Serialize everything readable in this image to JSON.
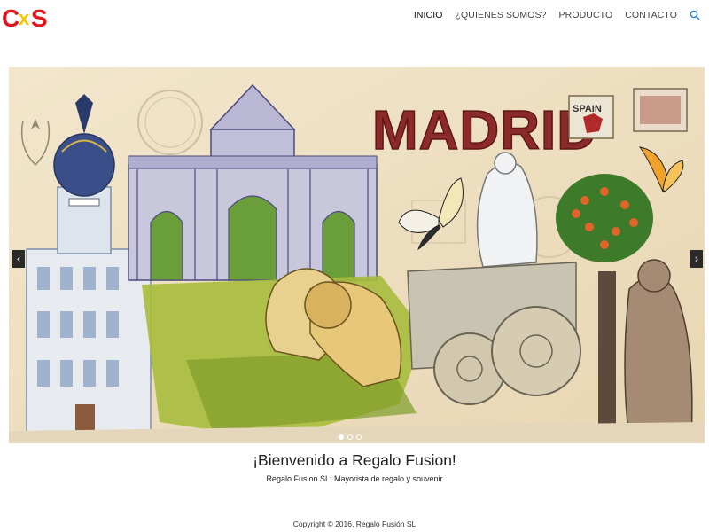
{
  "header": {
    "logo_text": "CxS",
    "nav": [
      {
        "label": "INICIO",
        "active": true
      },
      {
        "label": "¿QUIENES SOMOS?",
        "active": false
      },
      {
        "label": "PRODUCTO",
        "active": false
      },
      {
        "label": "CONTACTO",
        "active": false
      }
    ],
    "search_icon": "search-icon"
  },
  "carousel": {
    "slide_text": "MADRID",
    "stamp_text": "SPAIN",
    "prev_icon": "chevron-left-icon",
    "next_icon": "chevron-right-icon",
    "prev_glyph": "‹",
    "next_glyph": "›",
    "slide_count": 3,
    "active_slide": 1
  },
  "caption": {
    "title": "¡Bienvenido a Regalo Fusion!",
    "subtitle": "Regalo Fusion SL: Mayorista de regalo y souvenir"
  },
  "footer": {
    "copyright": "Copyright © 2016. Regalo Fusión SL"
  },
  "colors": {
    "logo_red": "#e3141b",
    "logo_yellow": "#f6c400",
    "madrid_title": "#8b2a2a",
    "accent_blue": "#2a7bd6"
  }
}
